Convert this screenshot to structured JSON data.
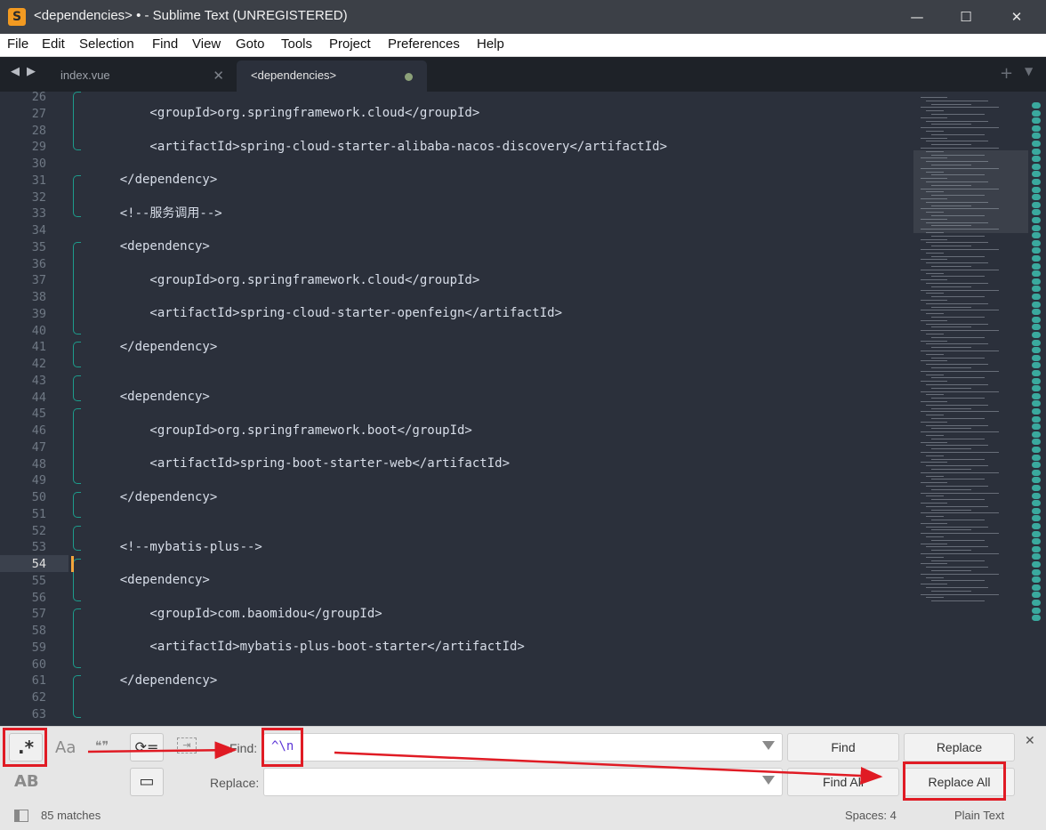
{
  "window": {
    "title": "<dependencies> • - Sublime Text (UNREGISTERED)",
    "app_icon": "S",
    "controls": {
      "minimize": "—",
      "maximize": "☐",
      "close": "✕"
    }
  },
  "menu": [
    "File",
    "Edit",
    "Selection",
    "Find",
    "View",
    "Goto",
    "Tools",
    "Project",
    "Preferences",
    "Help"
  ],
  "tabs": [
    {
      "label": "index.vue",
      "active": false,
      "close": "✕"
    },
    {
      "label": "<dependencies>",
      "active": true,
      "dirty": true
    }
  ],
  "tabbar": {
    "nav_left": "◀",
    "nav_right": "▶",
    "new_tab": "+",
    "dropdown": "▼"
  },
  "editor": {
    "current_line": "54",
    "lines": [
      {
        "n": "26",
        "text": ""
      },
      {
        "n": "27",
        "text": "        <groupId>org.springframework.cloud</groupId>"
      },
      {
        "n": "28",
        "text": ""
      },
      {
        "n": "29",
        "text": "        <artifactId>spring-cloud-starter-alibaba-nacos-discovery</artifactId>"
      },
      {
        "n": "30",
        "text": ""
      },
      {
        "n": "31",
        "text": "    </dependency>"
      },
      {
        "n": "32",
        "text": ""
      },
      {
        "n": "33",
        "text": "    <!--服务调用-->"
      },
      {
        "n": "34",
        "text": ""
      },
      {
        "n": "35",
        "text": "    <dependency>"
      },
      {
        "n": "36",
        "text": ""
      },
      {
        "n": "37",
        "text": "        <groupId>org.springframework.cloud</groupId>"
      },
      {
        "n": "38",
        "text": ""
      },
      {
        "n": "39",
        "text": "        <artifactId>spring-cloud-starter-openfeign</artifactId>"
      },
      {
        "n": "40",
        "text": ""
      },
      {
        "n": "41",
        "text": "    </dependency>"
      },
      {
        "n": "42",
        "text": ""
      },
      {
        "n": "43",
        "text": ""
      },
      {
        "n": "44",
        "text": "    <dependency>"
      },
      {
        "n": "45",
        "text": ""
      },
      {
        "n": "46",
        "text": "        <groupId>org.springframework.boot</groupId>"
      },
      {
        "n": "47",
        "text": ""
      },
      {
        "n": "48",
        "text": "        <artifactId>spring-boot-starter-web</artifactId>"
      },
      {
        "n": "49",
        "text": ""
      },
      {
        "n": "50",
        "text": "    </dependency>"
      },
      {
        "n": "51",
        "text": ""
      },
      {
        "n": "52",
        "text": ""
      },
      {
        "n": "53",
        "text": "    <!--mybatis-plus-->"
      },
      {
        "n": "54",
        "text": ""
      },
      {
        "n": "55",
        "text": "    <dependency>"
      },
      {
        "n": "56",
        "text": ""
      },
      {
        "n": "57",
        "text": "        <groupId>com.baomidou</groupId>"
      },
      {
        "n": "58",
        "text": ""
      },
      {
        "n": "59",
        "text": "        <artifactId>mybatis-plus-boot-starter</artifactId>"
      },
      {
        "n": "60",
        "text": ""
      },
      {
        "n": "61",
        "text": "    </dependency>"
      },
      {
        "n": "62",
        "text": ""
      },
      {
        "n": "63",
        "text": ""
      }
    ]
  },
  "find_panel": {
    "regex_toggle": ".*",
    "case_toggle": "Aa",
    "whole_word_toggle": "❝❞",
    "wrap_toggle": "⟳=",
    "in_selection_toggle": "⇥",
    "preserve_case_toggle": "AB",
    "highlight_toggle": "▭",
    "find_label": "Find:",
    "find_value": "^\\n",
    "replace_label": "Replace:",
    "replace_value": "",
    "find_button": "Find",
    "replace_button": "Replace",
    "find_all_button": "Find All",
    "replace_all_button": "Replace All",
    "close": "✕",
    "colors": {
      "annotation": "#e01b24",
      "regex_text": "#5b34d6"
    }
  },
  "status": {
    "matches": "85 matches",
    "spaces": "Spaces: 4",
    "syntax": "Plain Text"
  }
}
